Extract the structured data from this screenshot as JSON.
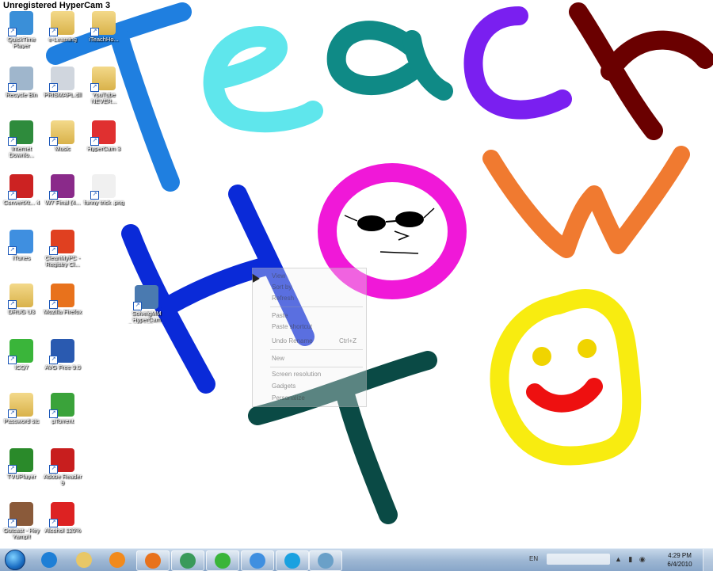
{
  "watermark": "Unregistered HyperCam 3",
  "desktop_icons": [
    {
      "label": "QuickTime Player",
      "icon": "quicktime-icon",
      "color": "#3a8fd8"
    },
    {
      "label": "e-Learning",
      "icon": "folder-icon",
      "color": "#e8c767"
    },
    {
      "label": "iTeachHo...",
      "icon": "folder-icon",
      "color": "#e8c767"
    },
    {
      "label": "Recycle Bin",
      "icon": "recycle-bin-icon",
      "color": "#9fb6cc"
    },
    {
      "label": "PRISMAPL.dll",
      "icon": "dll-file-icon",
      "color": "#d0d6de"
    },
    {
      "label": "YouTube NEVER...",
      "icon": "folder-icon",
      "color": "#e8c767"
    },
    {
      "label": "Internet Downlo...",
      "icon": "download-manager-icon",
      "color": "#2e8b3c"
    },
    {
      "label": "Music",
      "icon": "folder-icon",
      "color": "#e8c767"
    },
    {
      "label": "HyperCam 3",
      "icon": "hypercam-icon",
      "color": "#e03030"
    },
    {
      "label": "ConvertXt... 4",
      "icon": "convertx-icon",
      "color": "#cc2222"
    },
    {
      "label": "W7 Final (4...",
      "icon": "archive-icon",
      "color": "#8a2a8a"
    },
    {
      "label": "funny trick .png",
      "icon": "image-file-icon",
      "color": "#f0f0f0"
    },
    {
      "label": "iTunes",
      "icon": "itunes-icon",
      "color": "#3f8fe0"
    },
    {
      "label": "CleanMyPC - Registry Cl...",
      "icon": "cleanmypc-icon",
      "color": "#e04020"
    },
    {
      "label": "DRUG U3",
      "icon": "folder-icon",
      "color": "#e8c767"
    },
    {
      "label": "Mozilla Firefox",
      "icon": "firefox-icon",
      "color": "#e8721c"
    },
    {
      "label": "ICQ7",
      "icon": "icq-icon",
      "color": "#3ab53a"
    },
    {
      "label": "AVG Free 9.0",
      "icon": "avg-icon",
      "color": "#2a5ab0"
    },
    {
      "label": "Password stc",
      "icon": "folder-icon",
      "color": "#e8c767"
    },
    {
      "label": "µTorrent",
      "icon": "utorrent-icon",
      "color": "#3aa33a"
    },
    {
      "label": "TVUPlayer",
      "icon": "tvuplayer-icon",
      "color": "#2a8a2a"
    },
    {
      "label": "Adobe Reader 9",
      "icon": "adobe-reader-icon",
      "color": "#c81e1e"
    },
    {
      "label": "Outcast - Hey Yamp!!",
      "icon": "image-file-icon",
      "color": "#8a5a3a"
    },
    {
      "label": "Alcohol 120%",
      "icon": "alcohol-icon",
      "color": "#d22"
    },
    {
      "label": "SolveigMM HyperCam 3.0.0.108.exe",
      "icon": "installer-icon",
      "color": "#4a7ab0"
    }
  ],
  "context_menu": {
    "items": [
      "View",
      "Sort by",
      "Refresh",
      "Paste",
      "Paste shortcut",
      "Undo Rename",
      "New",
      "Screen resolution",
      "Gadgets",
      "Personalize"
    ],
    "undo_shortcut": "Ctrl+Z"
  },
  "taskbar": {
    "pinned": [
      {
        "name": "ie-icon",
        "color": "#1e7fd6"
      },
      {
        "name": "explorer-icon",
        "color": "#e8c767"
      },
      {
        "name": "media-player-icon",
        "color": "#f28a1c"
      },
      {
        "name": "firefox-icon",
        "color": "#e8721c"
      },
      {
        "name": "messenger-icon",
        "color": "#3a9a5a"
      },
      {
        "name": "icq-icon",
        "color": "#3ab53a"
      },
      {
        "name": "itunes-icon",
        "color": "#3f8fe0"
      },
      {
        "name": "skype-icon",
        "color": "#1aa1e0"
      },
      {
        "name": "hypercam-task-icon",
        "color": "#6aa0c8"
      }
    ],
    "language": "EN",
    "time": "4:29 PM",
    "date": "6/4/2010"
  }
}
